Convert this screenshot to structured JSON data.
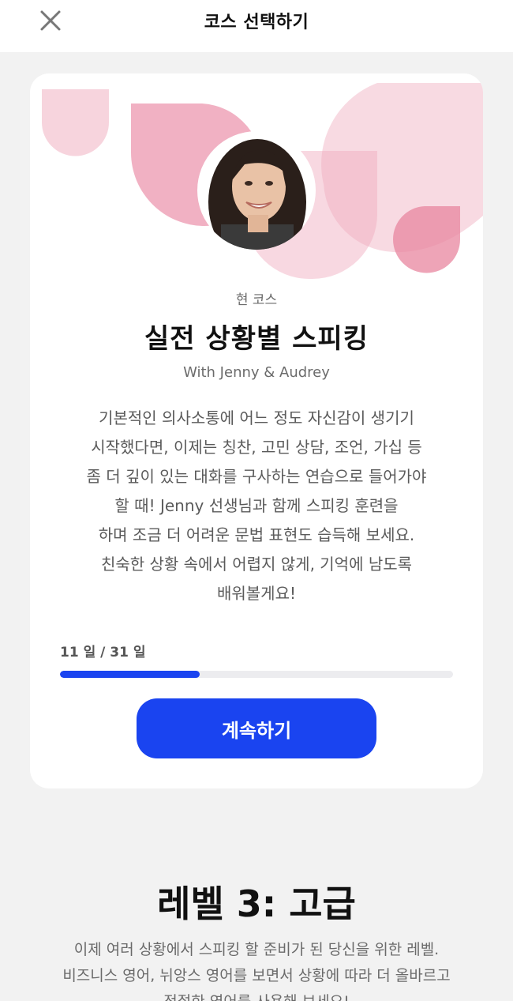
{
  "header": {
    "title": "코스 선택하기",
    "close_icon": "close-icon"
  },
  "current_course": {
    "label": "현 코스",
    "title": "실전 상황별 스피킹",
    "subtitle": "With Jenny & Audrey",
    "description_lines": [
      "기본적인 의사소통에 어느 정도 자신감이 생기기",
      "시작했다면, 이제는 칭찬, 고민 상담, 조언, 가십 등",
      "좀 더 깊이 있는 대화를 구사하는 연습으로 들어가야",
      "할 때! Jenny 선생님과 함께 스피킹 훈련을",
      "하며 조금 더 어려운 문법 표현도 습득해 보세요.",
      "친숙한 상황 속에서 어렵지 않게, 기억에 남도록",
      "배워볼게요!"
    ],
    "progress_text": "11 일 / 31 일",
    "progress_fraction": 0.355,
    "continue_label": "계속하기",
    "accent_color": "#1a44f0",
    "art_color": "#f0a8bc"
  },
  "next_level": {
    "title": "레벨 3: 고급",
    "description_lines": [
      "이제 여러 상황에서 스피킹 할 준비가 된 당신을 위한 레벨.",
      "비즈니스 영어, 뉘앙스 영어를 보면서 상황에 따라 더 올바르고",
      "적절한 영어를 사용해 보세요!"
    ]
  }
}
